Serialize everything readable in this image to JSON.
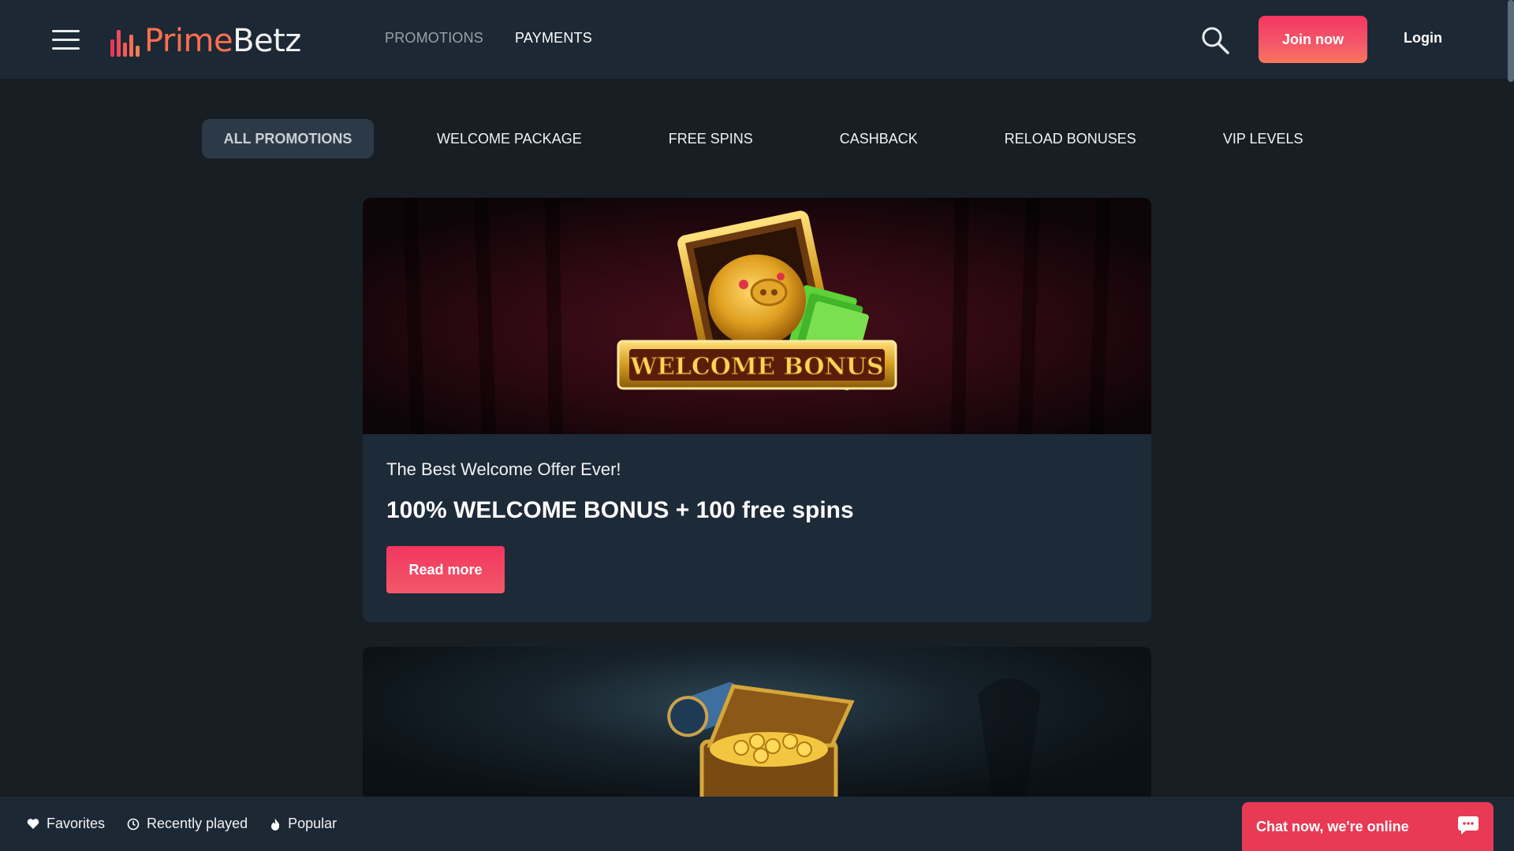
{
  "header": {
    "logo": {
      "part1": "Prime",
      "part2": "Betz"
    },
    "nav": [
      {
        "label": "PROMOTIONS",
        "active": false
      },
      {
        "label": "PAYMENTS",
        "active": true
      }
    ],
    "join_label": "Join now",
    "login_label": "Login",
    "icons": {
      "menu": "hamburger-menu-icon",
      "search": "search-icon"
    }
  },
  "tabs": [
    {
      "label": "ALL PROMOTIONS",
      "active": true
    },
    {
      "label": "WELCOME PACKAGE",
      "active": false
    },
    {
      "label": "FREE SPINS",
      "active": false
    },
    {
      "label": "CASHBACK",
      "active": false
    },
    {
      "label": "RELOAD BONUSES",
      "active": false
    },
    {
      "label": "VIP LEVELS",
      "active": false
    }
  ],
  "promotions": [
    {
      "banner_text": "WELCOME BONUS",
      "subtitle": "The Best Welcome Offer Ever!",
      "title": "100% WELCOME BONUS + 100 free spins",
      "button": "Read more"
    }
  ],
  "bottom_bar": {
    "items": [
      {
        "label": "Favorites",
        "icon": "heart-icon"
      },
      {
        "label": "Recently played",
        "icon": "clock-icon"
      },
      {
        "label": "Popular",
        "icon": "flame-icon"
      }
    ]
  },
  "chat": {
    "label": "Chat now, we're online",
    "icon": "chat-bubble-icon"
  },
  "colors": {
    "header_bg": "#1c2833",
    "page_bg": "#171e24",
    "card_bg": "#1d2a37",
    "accent": "#f2365f",
    "accent_orange": "#ff6f52",
    "tab_active_bg": "#2c3a47"
  }
}
